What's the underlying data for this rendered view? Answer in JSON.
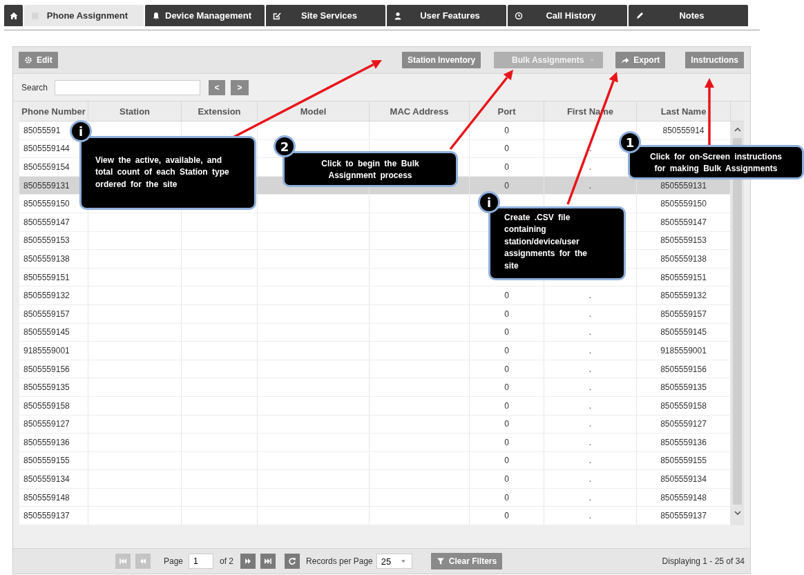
{
  "tabs": [
    {
      "kind": "home",
      "selected": false
    },
    {
      "label": "Phone Assignment",
      "selected": true
    },
    {
      "label": "Device Management",
      "selected": false
    },
    {
      "label": "Site Services",
      "selected": false
    },
    {
      "label": "User Features",
      "selected": false
    },
    {
      "label": "Call History",
      "selected": false
    },
    {
      "label": "Notes",
      "selected": false
    }
  ],
  "toolbar": {
    "buttons": [
      {
        "label": "Edit",
        "disabled": false
      },
      {
        "label": "Station Inventory",
        "disabled": false
      },
      {
        "label": "Bulk Assignments",
        "disabled": true
      },
      {
        "label": "Export",
        "disabled": false
      },
      {
        "label": "Instructions",
        "disabled": false
      }
    ]
  },
  "search": {
    "label": "Search",
    "prev": "<",
    "next": ">"
  },
  "table": {
    "columns": [
      "Phone Number",
      "Station",
      "Extension",
      "Model",
      "MAC Address",
      "Port",
      "First Name",
      "Last Name"
    ],
    "rows": [
      {
        "phone": "85055591",
        "port": "0",
        "last": "850555914",
        "selected": false
      },
      {
        "phone": "8505559144",
        "port": "0",
        "first": ".",
        "selected": false
      },
      {
        "phone": "8505559154",
        "port": "0",
        "first": ".",
        "selected": false
      },
      {
        "phone": "8505559131",
        "port": "0",
        "first": ".",
        "last": "8505559131",
        "selected": true
      },
      {
        "phone": "8505559150",
        "last": "8505559150",
        "selected": false
      },
      {
        "phone": "8505559147",
        "last": "8505559147",
        "selected": false
      },
      {
        "phone": "8505559153",
        "last": "8505559153",
        "selected": false
      },
      {
        "phone": "8505559138",
        "last": "8505559138",
        "selected": false
      },
      {
        "phone": "8505559151",
        "last": "8505559151",
        "selected": false
      },
      {
        "phone": "8505559132",
        "port": "0",
        "first": ".",
        "last": "8505559132",
        "selected": false
      },
      {
        "phone": "8505559157",
        "port": "0",
        "first": ".",
        "last": "8505559157",
        "selected": false
      },
      {
        "phone": "8505559145",
        "port": "0",
        "first": ".",
        "last": "8505559145",
        "selected": false
      },
      {
        "phone": "9185559001",
        "port": "0",
        "first": ".",
        "last": "9185559001",
        "selected": false
      },
      {
        "phone": "8505559156",
        "port": "0",
        "first": ".",
        "last": "8505559156",
        "selected": false
      },
      {
        "phone": "8505559135",
        "port": "0",
        "first": ".",
        "last": "8505559135",
        "selected": false
      },
      {
        "phone": "8505559158",
        "port": "0",
        "first": ".",
        "last": "8505559158",
        "selected": false
      },
      {
        "phone": "8505559127",
        "port": "0",
        "first": ".",
        "last": "8505559127",
        "selected": false
      },
      {
        "phone": "8505559136",
        "port": "0",
        "first": ".",
        "last": "8505559136",
        "selected": false
      },
      {
        "phone": "8505559155",
        "port": "0",
        "first": ".",
        "last": "8505559155",
        "selected": false
      },
      {
        "phone": "8505559134",
        "port": "0",
        "first": ".",
        "last": "8505559134",
        "selected": false
      },
      {
        "phone": "8505559148",
        "port": "0",
        "first": ".",
        "last": "8505559148",
        "selected": false
      },
      {
        "phone": "8505559137",
        "port": "0",
        "first": ".",
        "last": "8505559137",
        "selected": false
      }
    ]
  },
  "pager": {
    "nav": [
      {
        "kind": "first",
        "disabled": true
      },
      {
        "kind": "prev",
        "disabled": true
      },
      {
        "kind": "next",
        "disabled": false
      },
      {
        "kind": "last",
        "disabled": false
      }
    ],
    "page_label": "Page",
    "page": "1",
    "of": "of 2",
    "records_label": "Records per Page",
    "per_page": "25",
    "clear_filters": "Clear Filters",
    "summary": "Displaying 1 - 25 of 34"
  },
  "callouts": [
    {
      "badge": "i",
      "text": "View the active, available, and total count of each Station type ordered for the site"
    },
    {
      "badge": "2",
      "text": "Click to begin the Bulk Assignment process"
    },
    {
      "badge": "1",
      "text": "Click for on-Screen instructions for making Bulk Assignments"
    },
    {
      "badge": "i",
      "text": "Create .CSV file containing station/device/user assignments for the site"
    }
  ]
}
